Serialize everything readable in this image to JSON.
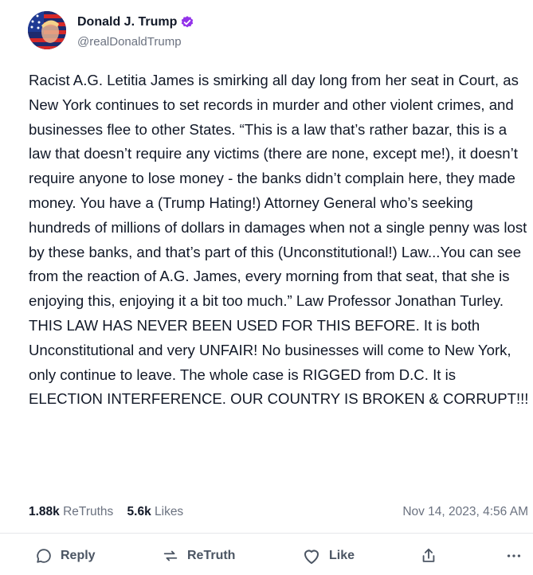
{
  "author": {
    "display_name": "Donald J. Trump",
    "handle": "@realDonaldTrump",
    "verified_icon": "verified-badge-icon",
    "verified_color": "#9333ea"
  },
  "post": {
    "text": "Racist A.G. Letitia James is smirking all day long from her seat in Court, as New York continues to set records in murder and other violent crimes, and businesses flee to other States. “This is a law that’s rather bazar, this is a law that doesn’t require any victims (there are none, except me!), it doesn’t require anyone to lose money - the banks didn’t complain here, they made money. You have a (Trump Hating!) Attorney General who’s seeking hundreds of millions of dollars in damages when not a single penny was lost by these banks, and that’s part of this (Unconstitutional!) Law...You can see from the reaction of A.G. James, every morning from that seat, that she is enjoying this, enjoying it a bit too much.” Law Professor Jonathan Turley. THIS LAW HAS NEVER BEEN USED FOR THIS BEFORE. It is both Unconstitutional and very UNFAIR! No businesses will come to New York, only continue to leave. The whole case is RIGGED from D.C. It is ELECTION INTERFERENCE. OUR COUNTRY IS BROKEN & CORRUPT!!!"
  },
  "stats": {
    "retruths_count": "1.88k",
    "retruths_label": "ReTruths",
    "likes_count": "5.6k",
    "likes_label": "Likes",
    "timestamp": "Nov 14, 2023, 4:56 AM"
  },
  "actions": {
    "reply": "Reply",
    "retruth": "ReTruth",
    "like": "Like",
    "share_icon": "share-icon",
    "more_icon": "more-icon"
  }
}
